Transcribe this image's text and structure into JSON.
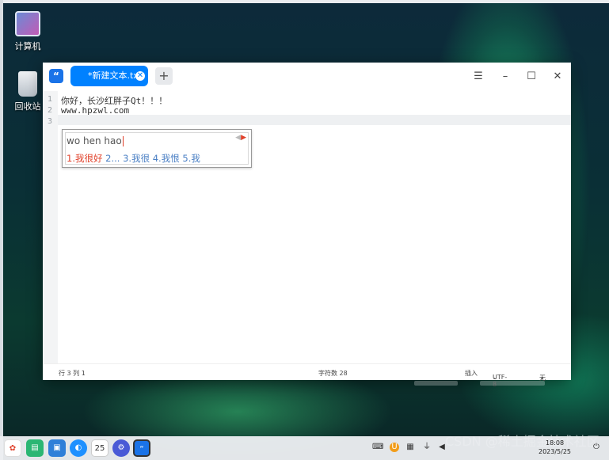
{
  "desktop": {
    "icons": [
      {
        "label": "计算机"
      },
      {
        "label": "回收站"
      }
    ]
  },
  "editor": {
    "tab": {
      "title": "*新建文本.txt"
    },
    "lines": [
      {
        "num": "1",
        "text": "你好，长沙红胖子Qt！！！"
      },
      {
        "num": "2",
        "text": "www.hpzwl.com"
      },
      {
        "num": "3",
        "text": ""
      }
    ],
    "ime": {
      "pinyin": "wo hen hao",
      "candidates": [
        {
          "text": "1.我很好",
          "selected": true
        },
        {
          "text": "2..."
        },
        {
          "text": "3.我很"
        },
        {
          "text": "4.我恨"
        },
        {
          "text": "5.我"
        }
      ]
    },
    "status": {
      "position": "行 3  列 1",
      "char_count": "字符数 28",
      "mode": "插入",
      "encoding": "UTF-8",
      "highlight": "无"
    }
  },
  "taskbar": {
    "calendar_day": "25",
    "clock_time": "18:08",
    "clock_date": "2023/5/25"
  },
  "watermark": "CSDN @稀土掘金技术社区",
  "colors": {
    "accent": "#0081ff",
    "ime_selected": "#e0402a",
    "ime_candidate": "#4a7fc4"
  }
}
